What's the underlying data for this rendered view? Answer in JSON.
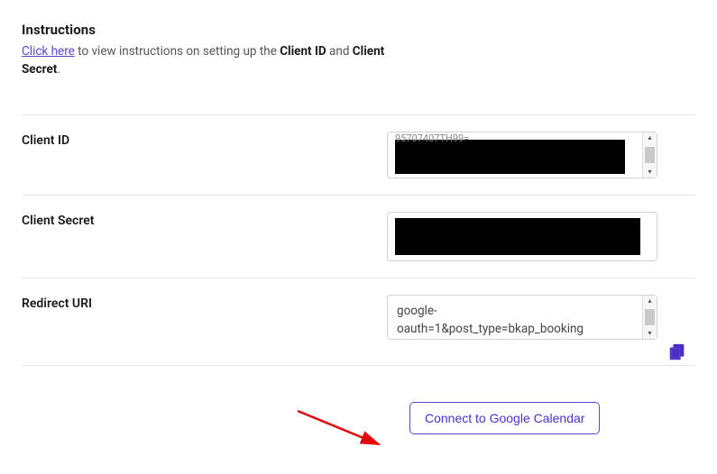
{
  "instructions": {
    "heading": "Instructions",
    "link_text": "Click here",
    "text_before_bold1": " to view instructions on setting up the ",
    "bold1": "Client ID",
    "text_between": " and ",
    "bold2": "Client Secret",
    "after": "."
  },
  "client_id": {
    "label": "Client ID",
    "partial_top": "95707407TH99="
  },
  "client_secret": {
    "label": "Client Secret"
  },
  "redirect_uri": {
    "label": "Redirect URI",
    "value_line1": "google-",
    "value_line2": "oauth=1&post_type=bkap_booking"
  },
  "button": {
    "connect": "Connect to Google Calendar"
  }
}
